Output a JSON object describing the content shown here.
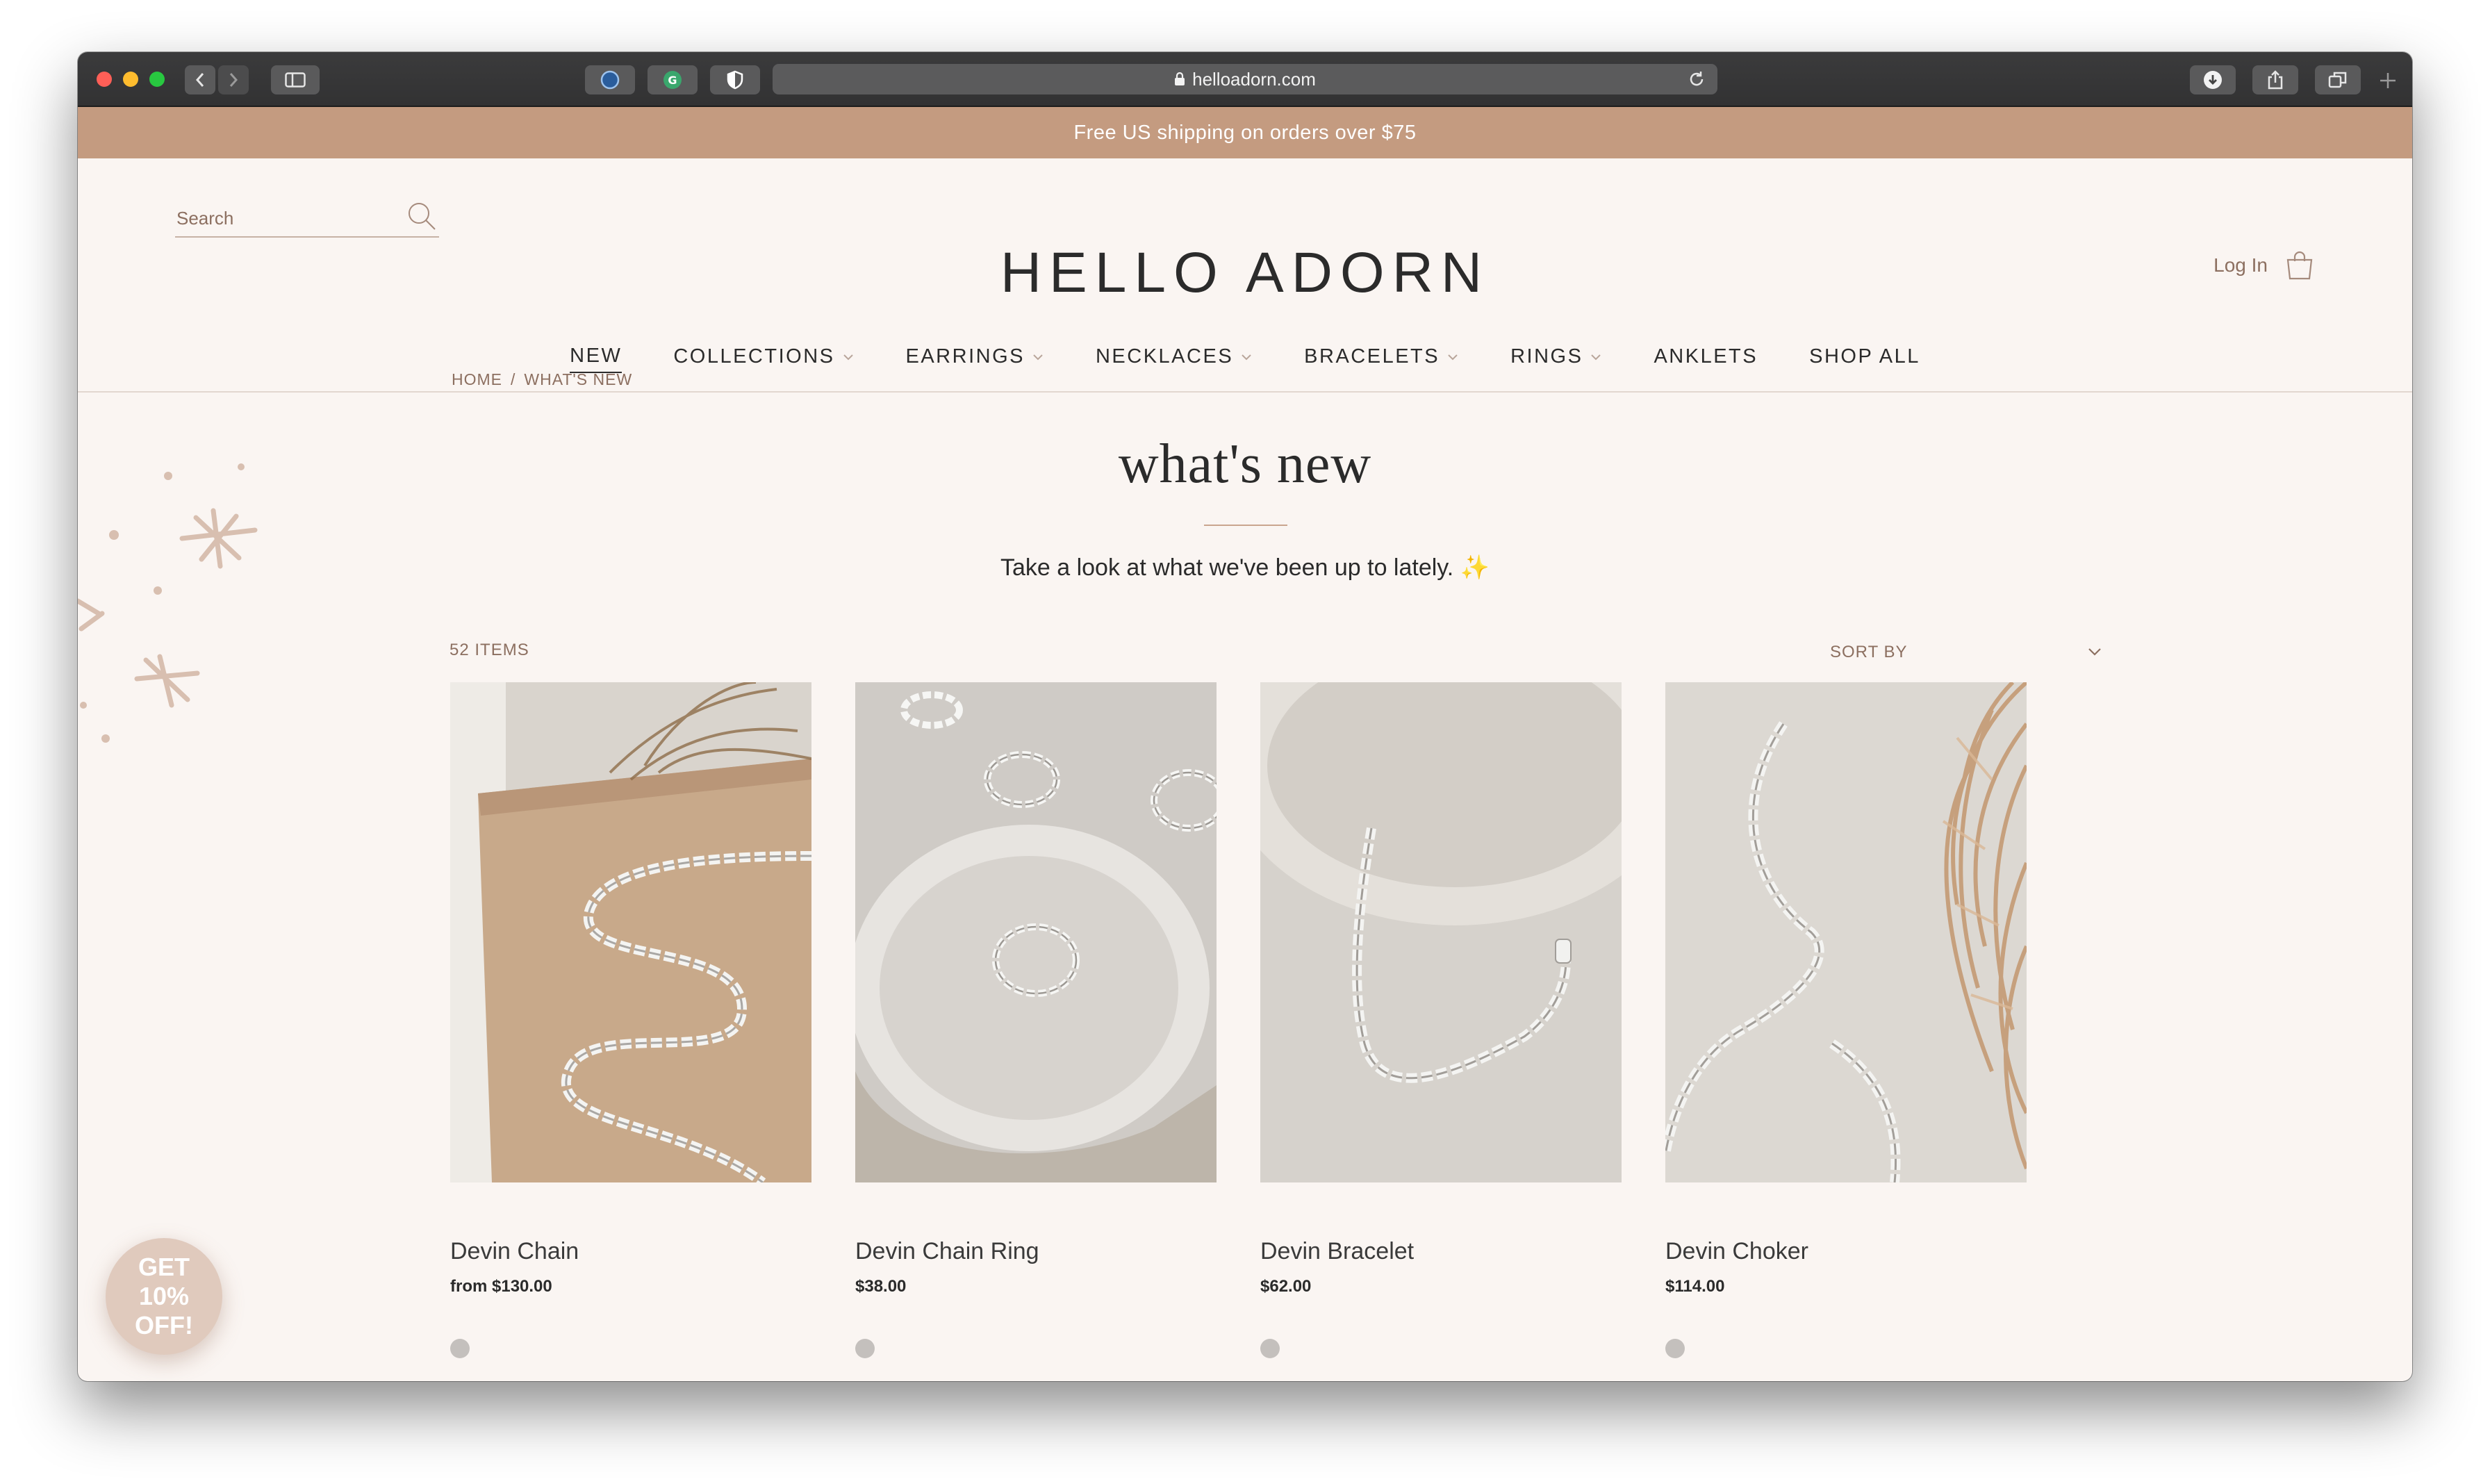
{
  "browser": {
    "url": "helloadorn.com"
  },
  "announcement": "Free US shipping on orders over $75",
  "header": {
    "search_placeholder": "Search",
    "logo": "HELLO ADORN",
    "login": "Log In"
  },
  "nav": [
    {
      "label": "NEW",
      "dropdown": false,
      "active": true
    },
    {
      "label": "COLLECTIONS",
      "dropdown": true
    },
    {
      "label": "EARRINGS",
      "dropdown": true
    },
    {
      "label": "NECKLACES",
      "dropdown": true
    },
    {
      "label": "BRACELETS",
      "dropdown": true
    },
    {
      "label": "RINGS",
      "dropdown": true
    },
    {
      "label": "ANKLETS",
      "dropdown": false
    },
    {
      "label": "SHOP ALL",
      "dropdown": false
    }
  ],
  "breadcrumb": {
    "home": "HOME",
    "separator": "/",
    "current": "WHAT'S NEW"
  },
  "page": {
    "title": "what's new",
    "intro": "Take a look at what we've been up to lately. ✨",
    "item_count": "52 ITEMS",
    "sort_label": "SORT BY"
  },
  "products": [
    {
      "name": "Devin Chain",
      "price": "from $130.00"
    },
    {
      "name": "Devin Chain Ring",
      "price": "$38.00"
    },
    {
      "name": "Devin Bracelet",
      "price": "$62.00"
    },
    {
      "name": "Devin Choker",
      "price": "$114.00"
    }
  ],
  "promo": {
    "line1": "GET",
    "line2": "10%",
    "line3": "OFF!"
  },
  "colors": {
    "accent": "#c49b80",
    "background": "#faf5f2",
    "text_muted": "#8c6f60"
  }
}
